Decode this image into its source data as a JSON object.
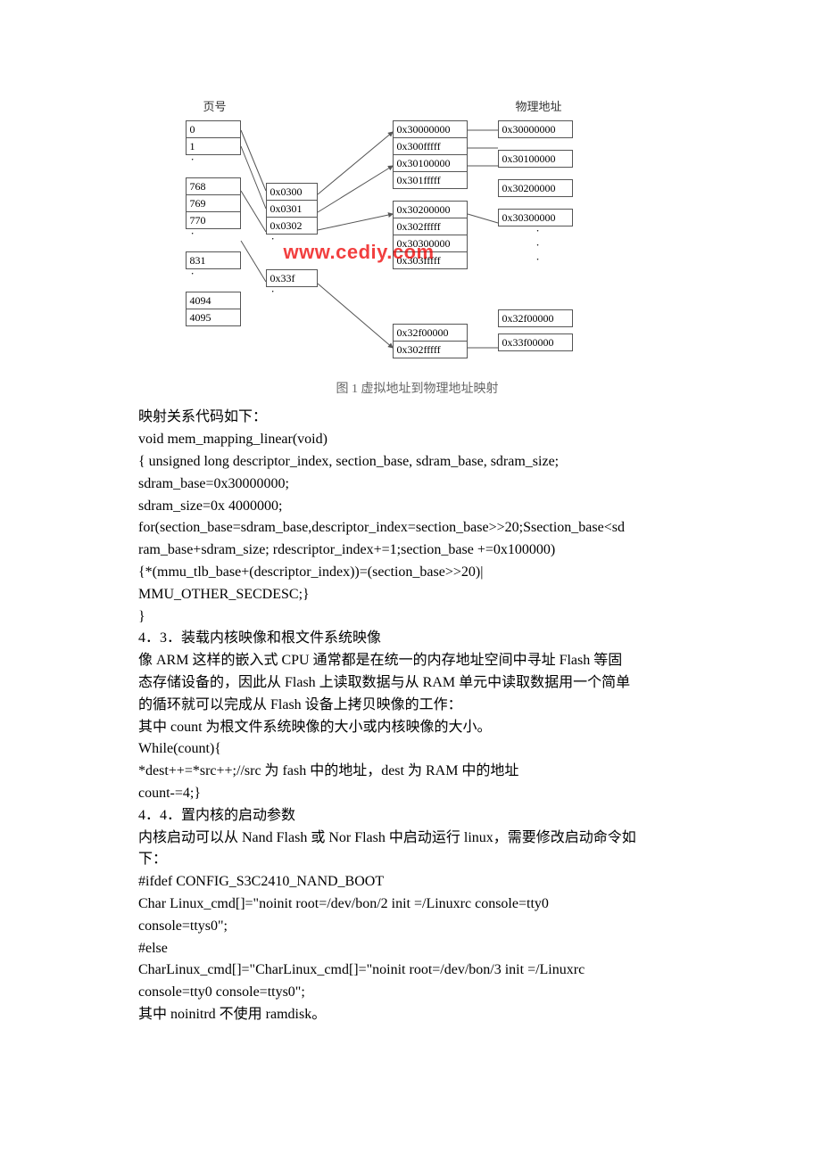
{
  "diagram": {
    "header_left": "页号",
    "header_right": "物理地址",
    "col1": [
      "0",
      "1",
      "768",
      "769",
      "770",
      "831",
      "4094",
      "4095"
    ],
    "col2": [
      "0x0300",
      "0x0301",
      "0x0302",
      "0x33f"
    ],
    "col3": [
      "0x30000000",
      "0x300fffff",
      "0x30100000",
      "0x301fffff",
      "0x30200000",
      "0x302fffff",
      "0x30300000",
      "0x303fffff",
      "0x32f00000",
      "0x302fffff"
    ],
    "col4": [
      "0x30000000",
      "0x30100000",
      "0x30200000",
      "0x30300000",
      "0x32f00000",
      "0x33f00000"
    ],
    "watermark": "www.cediy.com",
    "caption": "图 1 虚拟地址到物理地址映射"
  },
  "text": {
    "l1": "映射关系代码如下：",
    "l2": "void mem_mapping_linear(void)",
    "l3": "{   unsigned long descriptor_index, section_base, sdram_base, sdram_size;",
    "l4": "     sdram_base=0x30000000;",
    "l5": " sdram_size=0x 4000000;",
    "l6": " for(section_base=sdram_base,descriptor_index=section_base>>20;Ssection_base<sd",
    "l7": "ram_base+sdram_size; rdescriptor_index+=1;section_base +=0x100000)",
    "l8": "{*(mmu_tlb_base+(descriptor_index))=(section_base>>20)|",
    "l9": "MMU_OTHER_SECDESC;}",
    "l10": "}",
    "l11": "4．3．装载内核映像和根文件系统映像",
    "l12": "像 ARM 这样的嵌入式 CPU 通常都是在统一的内存地址空间中寻址  Flash  等固",
    "l13": "态存储设备的，因此从 Flash 上读取数据与从  RAM 单元中读取数据用一个简单",
    "l14": "的循环就可以完成从 Flash  设备上拷贝映像的工作：",
    "l15": "其中 count 为根文件系统映像的大小或内核映像的大小。",
    "l16": "While(count){",
    "l17": "*dest++=*src++;//src 为 fash 中的地址，dest 为 RAM 中的地址",
    "l18": "count-=4;}",
    "l19": "4．4．置内核的启动参数",
    "l20": "内核启动可以从 Nand Flash 或 Nor Flash 中启动运行 linux，需要修改启动命令如",
    "l21": "下：",
    "l22": "#ifdef CONFIG_S3C2410_NAND_BOOT",
    "l23": "Char Linux_cmd[]=\"noinit root=/dev/bon/2 init =/Linuxrc console=tty0",
    "l24": "console=ttys0\";",
    "l25": "#else",
    "l26": "CharLinux_cmd[]=\"CharLinux_cmd[]=\"noinit root=/dev/bon/3 init =/Linuxrc",
    "l27": "console=tty0 console=ttys0\";",
    "l28": "其中 noinitrd 不使用 ramdisk。"
  }
}
